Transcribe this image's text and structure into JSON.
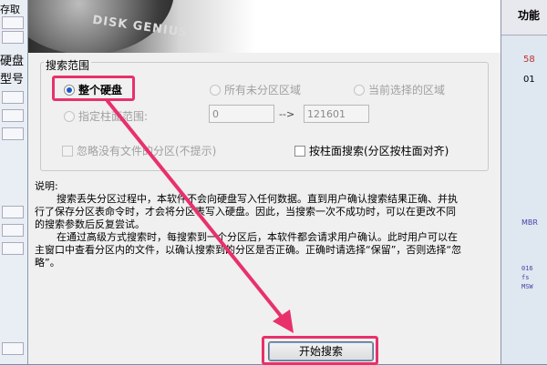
{
  "background_app": {
    "left_labels": [
      "存取",
      "硬盘",
      "型号"
    ],
    "right_header": "功能",
    "right_values": [
      "58",
      "01",
      "MBR"
    ],
    "hex_lines": [
      "016",
      "fs",
      "MSW"
    ]
  },
  "dialog": {
    "banner_text": "DISK GENIUS",
    "search_scope": {
      "title": "搜索范围",
      "options": {
        "whole_disk": "整个硬盘",
        "unpartitioned": "所有未分区区域",
        "selected_area": "当前选择的区域",
        "cylinder_range": "指定柱面范围:"
      },
      "cylinder_from": "0",
      "range_arrow": "-->",
      "cylinder_to": "121601"
    },
    "ignore_no_files": "忽略没有文件的分区(不提示)",
    "search_by_cylinder": "按柱面搜索(分区按柱面对齐)",
    "note": {
      "heading": "说明:",
      "para1": "搜索丢失分区过程中，本软件不会向硬盘写入任何数据。直到用户确认搜索结果正确、并执行了保存分区表命令时，才会将分区表写入硬盘。因此，当搜索一次不成功时，可以在更改不同的搜索参数后反复尝试。",
      "para2": "在通过高级方式搜索时，每搜索到一个分区后，本软件都会请求用户确认。此时用户可以在主窗口中查看分区内的文件，以确认搜索到的分区是否正确。正确时请选择“保留”，否则选择“忽略”。"
    },
    "start_button": "开始搜索"
  },
  "colors": {
    "annotation": "#e8316b",
    "selected_radio": "#1f57c8"
  }
}
